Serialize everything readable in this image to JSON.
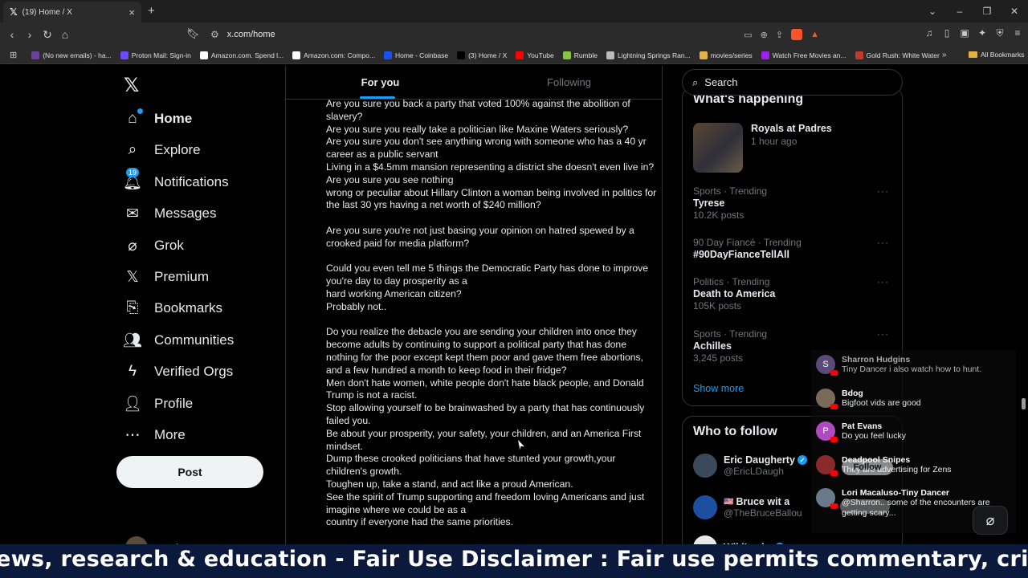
{
  "browser": {
    "tab_title": "(19) Home / X",
    "tab_icon": "x-logo",
    "url": "x.com/home",
    "bookmarks": [
      {
        "label": "(No new emails) - ha...",
        "color": "#6b3fa0"
      },
      {
        "label": "Proton Mail: Sign-in",
        "color": "#6d4aff"
      },
      {
        "label": "Amazon.com. Spend l...",
        "color": "#ffffff"
      },
      {
        "label": "Amazon.com: Compo...",
        "color": "#ffffff"
      },
      {
        "label": "Home - Coinbase",
        "color": "#1652f0"
      },
      {
        "label": "(3) Home / X",
        "color": "#000000"
      },
      {
        "label": "YouTube",
        "color": "#ff0000"
      },
      {
        "label": "Rumble",
        "color": "#85c742"
      },
      {
        "label": "Lightning Springs Ran...",
        "color": "#bbbbbb"
      },
      {
        "label": "movies/series",
        "color": "#e3b341"
      },
      {
        "label": "Watch Free Movies an...",
        "color": "#a020f0"
      },
      {
        "label": "Gold Rush: White Water",
        "color": "#c0392b"
      }
    ],
    "all_bookmarks": "All Bookmarks"
  },
  "sidebar": {
    "items": [
      {
        "label": "Home",
        "icon": "home-icon"
      },
      {
        "label": "Explore",
        "icon": "search-icon"
      },
      {
        "label": "Notifications",
        "icon": "bell-icon",
        "badge": "19"
      },
      {
        "label": "Messages",
        "icon": "mail-icon"
      },
      {
        "label": "Grok",
        "icon": "grok-icon"
      },
      {
        "label": "Premium",
        "icon": "x-icon"
      },
      {
        "label": "Bookmarks",
        "icon": "bookmark-icon"
      },
      {
        "label": "Communities",
        "icon": "communities-icon"
      },
      {
        "label": "Verified Orgs",
        "icon": "lightning-icon"
      },
      {
        "label": "Profile",
        "icon": "person-icon"
      },
      {
        "label": "More",
        "icon": "more-icon"
      }
    ],
    "post_label": "Post",
    "user_name": "Hawks Mustar..."
  },
  "feed": {
    "tabs": [
      "For you",
      "Following"
    ],
    "post_lines": [
      "Are you sure you back a party that voted 100% against the abolition of slavery?",
      "Are you sure you really take a politician like Maxine Waters seriously?",
      "Are you sure you don't see anything wrong with someone who has a 40 yr career as a public servant",
      "Living in a $4.5mm mansion representing a district she doesn't even live in?",
      "Are you sure you see nothing",
      "wrong or peculiar about Hillary Clinton a woman being involved in politics for the last 30 yrs having a net worth of $240 million?",
      "",
      "Are you sure you're not just basing your opinion on hatred spewed by a crooked paid for media platform?",
      "",
      "Could you even tell me 5 things the Democratic Party has done to improve you're day to day prosperity as a",
      "hard working American citizen?",
      "Probably not..",
      "",
      "Do you realize the debacle you are sending your children into once they become adults by continuing to support a political party that has done nothing for the poor except kept them poor and gave them free abortions, and a few hundred a month to keep food in their fridge?",
      "Men don't hate women, white people don't hate black people, and Donald Trump is not a racist.",
      "Stop allowing yourself to be brainwashed by a party that has continuously failed you.",
      "Be about your prosperity, your safety, your children, and an America First mindset.",
      "Dump these crooked politicians that have stunted your growth,your children's growth.",
      "Toughen up, take a stand, and act like a proud American.",
      "See the spirit of Trump supporting and freedom loving Americans and just imagine where we could be as a",
      "country if everyone had the same priorities."
    ]
  },
  "search": {
    "placeholder": "Search"
  },
  "happening": {
    "title": "What's happening",
    "top": {
      "title": "Royals at Padres",
      "time": "1 hour ago"
    },
    "trends": [
      {
        "meta": "Sports · Trending",
        "name": "Tyrese",
        "posts": "10.2K posts"
      },
      {
        "meta": "90 Day Fiancé · Trending",
        "name": "#90DayFianceTellAll",
        "posts": ""
      },
      {
        "meta": "Politics · Trending",
        "name": "Death to America",
        "posts": "105K posts"
      },
      {
        "meta": "Sports · Trending",
        "name": "Achilles",
        "posts": "3,245 posts"
      }
    ],
    "show_more": "Show more"
  },
  "who_to_follow": {
    "title": "Who to follow",
    "users": [
      {
        "name": "Eric Daugherty",
        "handle": "@EricLDaugh"
      },
      {
        "name": "Bruce wit a",
        "handle": "@TheBruceBallou"
      },
      {
        "name": "WikiLeaks",
        "handle": ""
      }
    ],
    "follow_label": "Follow"
  },
  "chat": {
    "messages": [
      {
        "name": "Sharron Hudgins",
        "text": "Tiny Dancer i also watch how to hunt.",
        "initial": "S",
        "color": "#5b4a7a"
      },
      {
        "name": "Bdog",
        "text": "Bigfoot vids are good",
        "initial": "",
        "color": "#7a6a5a"
      },
      {
        "name": "Pat Evans",
        "text": "Do you feel lucky",
        "initial": "P",
        "color": "#b04ac0"
      },
      {
        "name": "Deadpool Snipes",
        "text": "They are advertising for Zens",
        "initial": "",
        "color": "#8a2a2a"
      },
      {
        "name": "Lori Macaluso-Tiny Dancer",
        "text": "@Sharron.. some of the encounters are getting scary...",
        "initial": "",
        "color": "#6a7a8a"
      }
    ]
  },
  "ticker": {
    "text": "ews, research & education - Fair Use Disclaimer : Fair use permits commentary, critici"
  }
}
